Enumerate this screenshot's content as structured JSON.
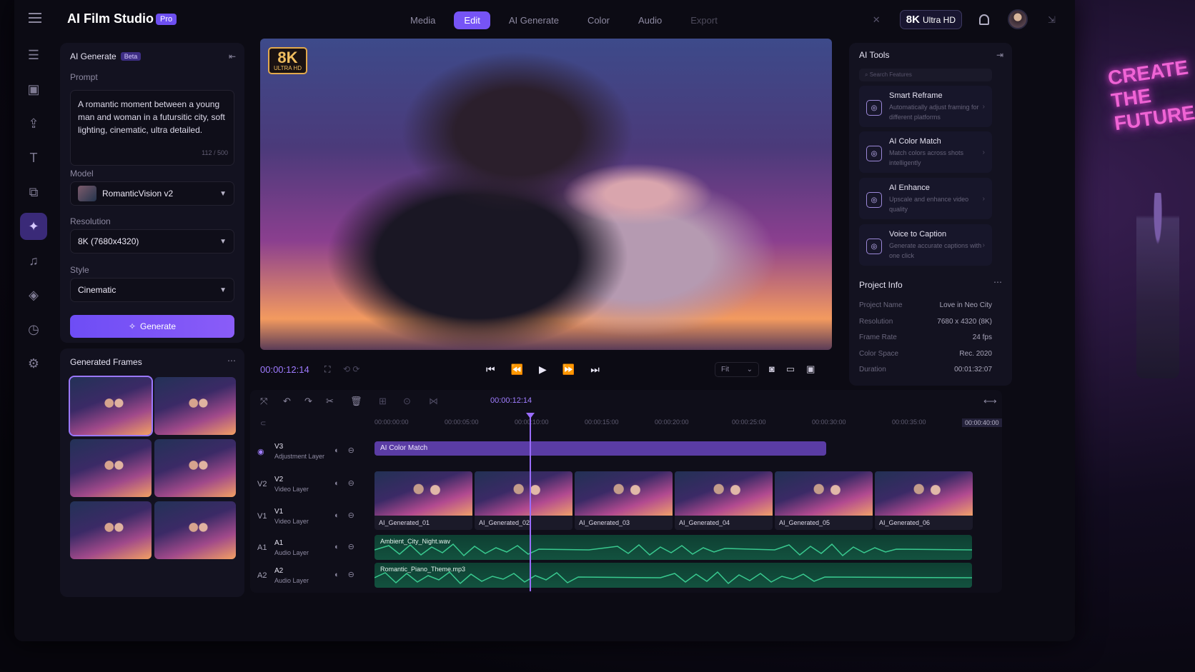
{
  "app": {
    "title": "AI Film Studio",
    "badge": "Pro"
  },
  "nav": {
    "tabs": [
      "Media",
      "Edit",
      "AI Generate",
      "Color",
      "Audio",
      "Export"
    ],
    "active": "Edit"
  },
  "topright": {
    "quality_big": "8K",
    "quality_label": "Ultra HD"
  },
  "left": {
    "title": "AI Generate",
    "beta": "Beta",
    "prompt_label": "Prompt",
    "prompt_text": "A romantic moment between a young man and woman in a futursitic city, soft lighting, cinematic, ultra detailed.",
    "char_count": "112 / 500",
    "model_label": "Model",
    "model_value": "RomanticVision v2",
    "resolution_label": "Resolution",
    "resolution_value": "8K (7680x4320)",
    "style_label": "Style",
    "style_value": "Cinematic",
    "generate_label": "Generate",
    "frames_title": "Generated Frames"
  },
  "viewer": {
    "badge_big": "8K",
    "badge_small": "ULTRA HD",
    "timecode": "00:00:12:14",
    "fit": "Fit"
  },
  "ai_tools": {
    "title": "AI Tools",
    "search_placeholder": "Search Features",
    "tools": [
      {
        "name": "Smart Reframe",
        "desc": "Automatically adjust framing for different platforms"
      },
      {
        "name": "AI Color Match",
        "desc": "Match colors across shots intelligently"
      },
      {
        "name": "AI Enhance",
        "desc": "Upscale and enhance video quality"
      },
      {
        "name": "Voice to Caption",
        "desc": "Generate accurate captions with one click"
      }
    ]
  },
  "project": {
    "title": "Project Info",
    "rows": [
      {
        "k": "Project Name",
        "v": "Love in Neo City"
      },
      {
        "k": "Resolution",
        "v": "7680 x 4320 (8K)"
      },
      {
        "k": "Frame Rate",
        "v": "24 fps"
      },
      {
        "k": "Color Space",
        "v": "Rec. 2020"
      },
      {
        "k": "Duration",
        "v": "00:01:32:07"
      }
    ]
  },
  "timeline": {
    "timecode": "00:00:12:14",
    "ruler": [
      "00:00:00:00",
      "00:00:05:00",
      "00:00:10:00",
      "00:00:15:00",
      "00:00:20:00",
      "00:00:25:00",
      "00:00:30:00",
      "00:00:35:00",
      "00:00:40:00"
    ],
    "tracks": [
      {
        "id": "V3",
        "name": "V3",
        "sub": "Adjustment Layer"
      },
      {
        "id": "V2",
        "name": "V2",
        "sub": "Video Layer"
      },
      {
        "id": "V1",
        "name": "V1",
        "sub": "Video Layer"
      },
      {
        "id": "A1",
        "name": "A1",
        "sub": "Audio Layer"
      },
      {
        "id": "A2",
        "name": "A2",
        "sub": "Audio Layer"
      }
    ],
    "adjust_clip": "AI Color Match",
    "clips": [
      "AI_Generated_01",
      "AI_Generated_02",
      "AI_Generated_03",
      "AI_Generated_04",
      "AI_Generated_05",
      "AI_Generated_06"
    ],
    "audio": [
      "Ambient_City_Night.wav",
      "Romantic_Piano_Theme.mp3"
    ]
  },
  "neon": [
    "CREATE",
    "THE",
    "FUTURE"
  ]
}
